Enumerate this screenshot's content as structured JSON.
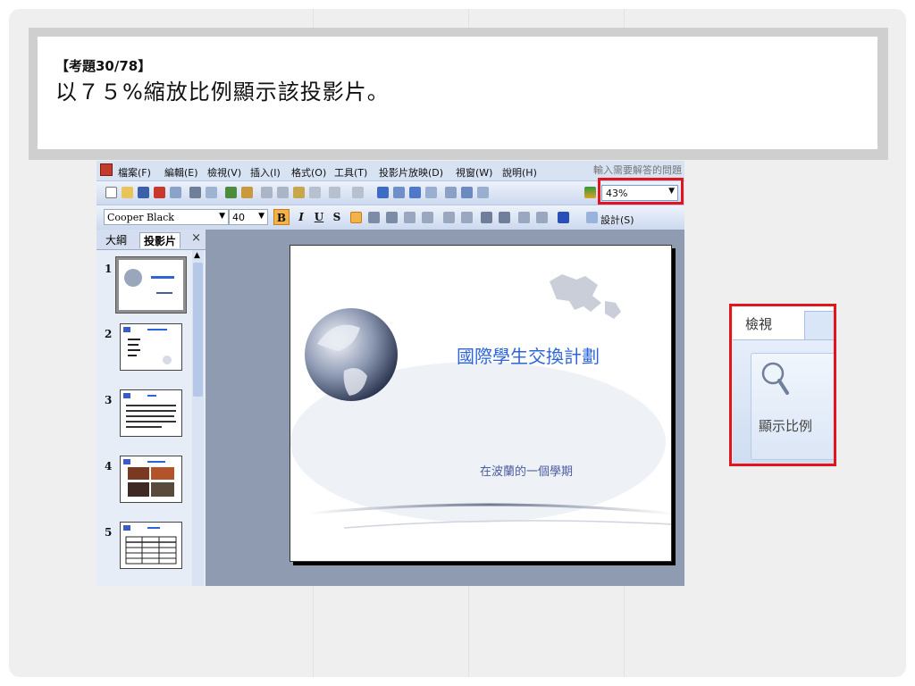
{
  "question": {
    "number": "【考題30/78】",
    "text": "以７５%縮放比例顯示該投影片。"
  },
  "app": {
    "menu": [
      "檔案(F)",
      "編輯(E)",
      "檢視(V)",
      "插入(I)",
      "格式(O)",
      "工具(T)",
      "投影片放映(D)",
      "視窗(W)",
      "說明(H)"
    ],
    "help_placeholder": "輸入需要解答的問題",
    "zoom_value": "43%",
    "font_name": "Cooper Black",
    "font_size": "40",
    "format_buttons": [
      "B",
      "I",
      "U",
      "S"
    ],
    "design_label": "設計(S)",
    "panel_tabs": {
      "outline": "大綱",
      "slides": "投影片"
    },
    "thumbnails": [
      "1",
      "2",
      "3",
      "4",
      "5"
    ],
    "slide": {
      "title": "國際學生交換計劃",
      "subtitle": "在波蘭的一個學期"
    }
  },
  "ribbon": {
    "tab_label": "檢視",
    "button_label": "顯示比例"
  },
  "colors": {
    "highlight": "#e3141b",
    "slide_title": "#2d65d8",
    "app_background": "#8f9bb0"
  }
}
